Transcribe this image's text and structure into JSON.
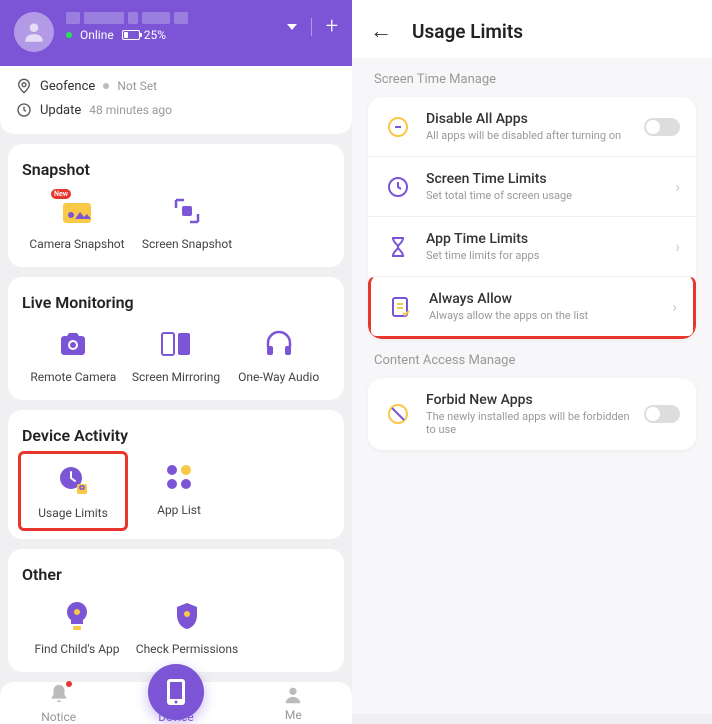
{
  "header": {
    "status_online": "Online",
    "battery": "25%"
  },
  "status_rows": {
    "geofence_label": "Geofence",
    "geofence_value": "Not Set",
    "update_label": "Update",
    "update_value": "48 minutes ago"
  },
  "sections": {
    "snapshot": {
      "title": "Snapshot",
      "camera": "Camera Snapshot",
      "screen": "Screen Snapshot",
      "badge": "New"
    },
    "live": {
      "title": "Live Monitoring",
      "remote_camera": "Remote Camera",
      "screen_mirror": "Screen Mirroring",
      "one_way_audio": "One-Way Audio"
    },
    "device_activity": {
      "title": "Device Activity",
      "usage_limits": "Usage Limits",
      "app_list": "App List"
    },
    "other": {
      "title": "Other",
      "find_child": "Find Child's App",
      "check_perm": "Check Permissions"
    }
  },
  "bottomnav": {
    "notice": "Notice",
    "device": "Device",
    "me": "Me"
  },
  "right": {
    "title": "Usage Limits",
    "section1": "Screen Time Manage",
    "section2": "Content Access Manage",
    "items": {
      "disable_all": {
        "title": "Disable All Apps",
        "sub": "All apps will be disabled after turning on"
      },
      "screen_time": {
        "title": "Screen Time Limits",
        "sub": "Set total time of screen usage"
      },
      "app_time": {
        "title": "App Time Limits",
        "sub": "Set time limits for apps"
      },
      "always_allow": {
        "title": "Always Allow",
        "sub": "Always allow the apps on the list"
      },
      "forbid_new": {
        "title": "Forbid New Apps",
        "sub": "The newly installed apps will be forbidden to use"
      }
    }
  }
}
